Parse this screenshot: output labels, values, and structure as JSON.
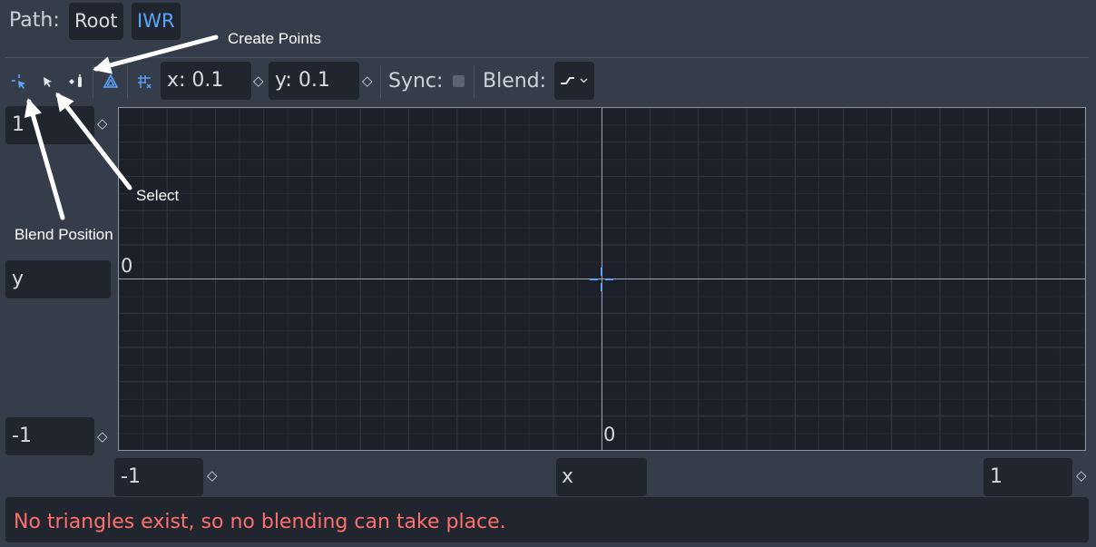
{
  "header": {
    "path_label": "Path:",
    "breadcrumbs": [
      "Root",
      "IWR"
    ]
  },
  "toolbar": {
    "tools": [
      {
        "icon": "blend-position-icon",
        "active": true
      },
      {
        "icon": "select-icon",
        "active": false
      },
      {
        "icon": "create-points-icon",
        "active": false
      },
      {
        "icon": "create-triangles-icon",
        "active": false
      },
      {
        "icon": "snap-grid-icon",
        "active": false
      }
    ],
    "snap_x": "x: 0.1",
    "snap_y": "y: 0.1",
    "sync_label": "Sync:",
    "sync_checked": false,
    "blend_label": "Blend:",
    "blend_value_icon": "blend-curve-icon"
  },
  "blend_space": {
    "max_y": "1",
    "y_label": "y",
    "min_y": "-1",
    "min_x": "-1",
    "x_label": "x",
    "max_x": "1",
    "origin_label_y": "0",
    "origin_label_x": "0",
    "blend_position": {
      "x": 0,
      "y": 0
    }
  },
  "status": {
    "message": "No triangles exist, so no blending can take place.",
    "color": "#ff6f6f"
  },
  "annotations": {
    "create_points": "Create Points",
    "select": "Select",
    "blend_position": "Blend Position"
  },
  "colors": {
    "accent": "#59a6ff",
    "background": "#363d4a",
    "field": "#21252d",
    "canvas": "#1d2029"
  }
}
